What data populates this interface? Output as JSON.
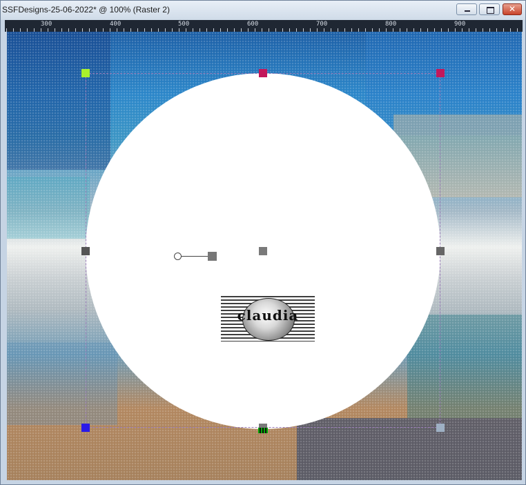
{
  "window": {
    "title": "SSFDesigns-25-06-2022* @ 100% (Raster 2)",
    "buttons": {
      "minimize": "minimize",
      "maximize": "maximize",
      "close": "✕"
    }
  },
  "ruler": {
    "labels": [
      "300",
      "400",
      "500",
      "600",
      "700",
      "800",
      "900"
    ]
  },
  "canvas": {
    "watermark_text": "claudia",
    "colors": {
      "selection_top_left": "#a9f02d",
      "selection_top": "#c2185b",
      "selection_bottom_left": "#2a1be8",
      "shape_fill": "#ffffff"
    }
  }
}
